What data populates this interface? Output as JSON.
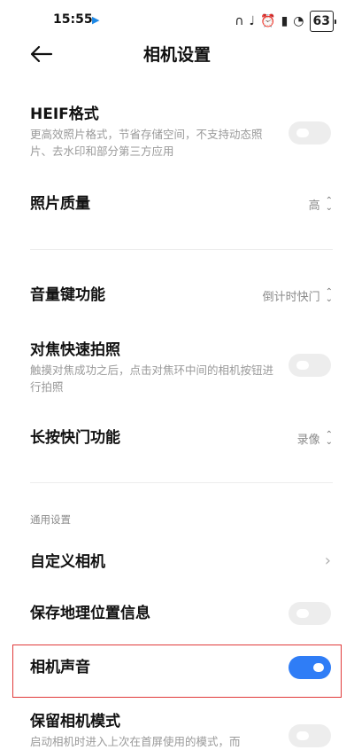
{
  "status_bar": {
    "time": "15:55",
    "play_icon": "play-store-icon",
    "icons": [
      "headphones-icon",
      "mute-icon",
      "alarm-icon",
      "hd-signal-icon",
      "wifi-icon"
    ],
    "battery": "63",
    "accent": "#1e88e5"
  },
  "nav": {
    "title": "相机设置",
    "back_icon": "back-arrow-icon"
  },
  "rows": {
    "heif": {
      "title": "HEIF格式",
      "desc": "更高效照片格式，节省存储空间，不支持动态照片、去水印和部分第三方应用",
      "toggle_on": false
    },
    "quality": {
      "title": "照片质量",
      "value": "高"
    },
    "volume_key": {
      "title": "音量键功能",
      "value": "倒计时快门"
    },
    "focus_shoot": {
      "title": "对焦快速拍照",
      "desc": "触摸对焦成功之后，点击对焦环中间的相机按钮进行拍照",
      "toggle_on": false
    },
    "long_press": {
      "title": "长按快门功能",
      "value": "录像"
    },
    "custom_camera": {
      "title": "自定义相机"
    },
    "save_location": {
      "title": "保存地理位置信息",
      "toggle_on": false
    },
    "camera_sound": {
      "title": "相机声音",
      "toggle_on": true
    },
    "keep_mode": {
      "title": "保留相机模式",
      "desc": "启动相机时进入上次在首屏使用的模式，而",
      "toggle_on": false
    }
  },
  "section": {
    "general": "通用设置"
  },
  "colors": {
    "toggle_on": "#2f7df6",
    "toggle_off": "#ededed",
    "highlight": "#e03a3a"
  }
}
